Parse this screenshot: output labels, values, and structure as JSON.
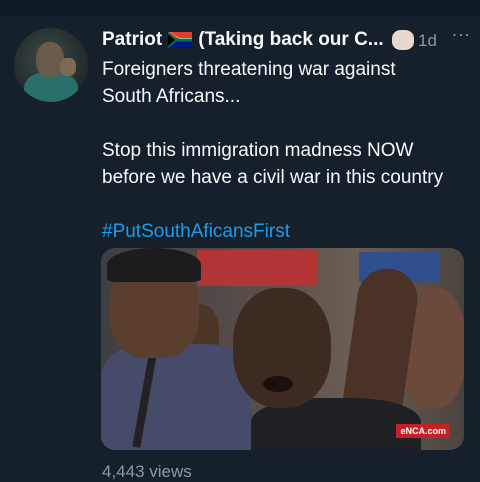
{
  "tweet": {
    "author_name": "Patriot",
    "author_suffix": "(Taking back our C...",
    "time": "1d",
    "text_line1": "Foreigners threatening war against",
    "text_line2": "South Africans...",
    "text_line3": "Stop this immigration madness NOW",
    "text_line4": "before we have a civil war in this country",
    "hashtag": "#PutSouthAficansFirst",
    "media_logo": "eNCA.com",
    "views": "4,443 views"
  },
  "colors": {
    "background": "#15202b",
    "link": "#1d9bf0",
    "secondary_text": "#8b98a5"
  },
  "icons": {
    "flag": "south-africa-flag-icon",
    "emoji": "raised-fist-icon",
    "more": "more-vertical-icon"
  }
}
